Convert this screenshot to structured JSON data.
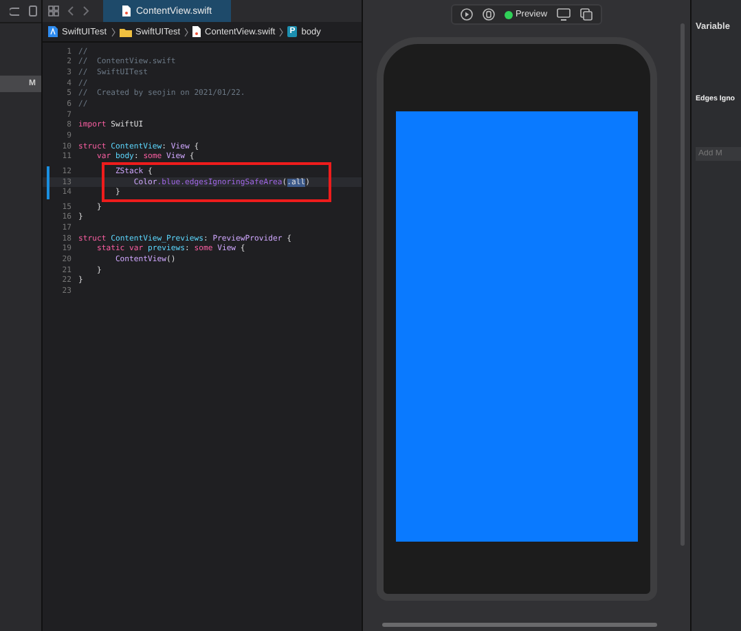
{
  "navigator": {
    "badge": "M"
  },
  "editor": {
    "tabs": [
      {
        "label": "ContentView.swift",
        "selected": true
      }
    ],
    "breadcrumb": [
      {
        "kind": "project",
        "label": "SwiftUITest"
      },
      {
        "kind": "folder",
        "label": "SwiftUITest"
      },
      {
        "kind": "file",
        "label": "ContentView.swift"
      },
      {
        "kind": "property",
        "badge": "P",
        "label": "body"
      }
    ],
    "lines": [
      {
        "number": "1",
        "changed": false,
        "current": false,
        "tokens": [
          {
            "kind": "comment",
            "text": "//"
          }
        ]
      },
      {
        "number": "2",
        "changed": false,
        "current": false,
        "tokens": [
          {
            "kind": "comment",
            "text": "//  ContentView.swift"
          }
        ]
      },
      {
        "number": "3",
        "changed": false,
        "current": false,
        "tokens": [
          {
            "kind": "comment",
            "text": "//  SwiftUITest"
          }
        ]
      },
      {
        "number": "4",
        "changed": false,
        "current": false,
        "tokens": [
          {
            "kind": "comment",
            "text": "//"
          }
        ]
      },
      {
        "number": "5",
        "changed": false,
        "current": false,
        "tokens": [
          {
            "kind": "comment",
            "text": "//  Created by seojin on 2021/01/22."
          }
        ]
      },
      {
        "number": "6",
        "changed": false,
        "current": false,
        "tokens": [
          {
            "kind": "comment",
            "text": "//"
          }
        ]
      },
      {
        "number": "7",
        "changed": false,
        "current": false
      },
      {
        "number": "8",
        "changed": false,
        "current": false,
        "tokens": [
          {
            "kind": "keyword",
            "text": "import "
          },
          {
            "kind": "plain",
            "text": "SwiftUI"
          }
        ]
      },
      {
        "number": "9",
        "changed": false,
        "current": false
      },
      {
        "number": "10",
        "changed": false,
        "current": false,
        "tokens": [
          {
            "kind": "keyword",
            "text": "struct "
          },
          {
            "kind": "decl",
            "text": "ContentView"
          },
          {
            "kind": "plain",
            "text": ": "
          },
          {
            "kind": "type",
            "text": "View"
          },
          {
            "kind": "plain",
            "text": " {"
          }
        ]
      },
      {
        "number": "11",
        "changed": false,
        "current": false,
        "tokens": [
          {
            "kind": "keyword",
            "text": "    var "
          },
          {
            "kind": "decl",
            "text": "body"
          },
          {
            "kind": "plain",
            "text": ": "
          },
          {
            "kind": "keyword",
            "text": "some "
          },
          {
            "kind": "type",
            "text": "View"
          },
          {
            "kind": "plain",
            "text": " {"
          }
        ]
      },
      {
        "number": "12",
        "changed": true,
        "current": false,
        "tokens": [
          {
            "kind": "type",
            "text": "        ZStack"
          },
          {
            "kind": "plain",
            "text": " {"
          }
        ]
      },
      {
        "number": "13",
        "changed": true,
        "current": true,
        "tokens": [
          {
            "kind": "type",
            "text": "            Color"
          },
          {
            "kind": "member",
            "text": ".blue"
          },
          {
            "kind": "member",
            "text": ".edgesIgnoringSafeArea"
          },
          {
            "kind": "plain",
            "text": "("
          },
          {
            "kind": "selection",
            "text": ".all"
          },
          {
            "kind": "plain",
            "text": ")"
          }
        ]
      },
      {
        "number": "14",
        "changed": true,
        "current": false,
        "tokens": [
          {
            "kind": "plain",
            "text": "        }"
          }
        ]
      },
      {
        "number": "15",
        "changed": false,
        "current": false,
        "tokens": [
          {
            "kind": "plain",
            "text": "    }"
          }
        ]
      },
      {
        "number": "16",
        "changed": false,
        "current": false,
        "tokens": [
          {
            "kind": "plain",
            "text": "}"
          }
        ]
      },
      {
        "number": "17",
        "changed": false,
        "current": false
      },
      {
        "number": "18",
        "changed": false,
        "current": false,
        "tokens": [
          {
            "kind": "keyword",
            "text": "struct "
          },
          {
            "kind": "decl",
            "text": "ContentView_Previews"
          },
          {
            "kind": "plain",
            "text": ": "
          },
          {
            "kind": "type",
            "text": "PreviewProvider"
          },
          {
            "kind": "plain",
            "text": " {"
          }
        ]
      },
      {
        "number": "19",
        "changed": false,
        "current": false,
        "tokens": [
          {
            "kind": "keyword",
            "text": "    static var "
          },
          {
            "kind": "decl",
            "text": "previews"
          },
          {
            "kind": "plain",
            "text": ": "
          },
          {
            "kind": "keyword",
            "text": "some "
          },
          {
            "kind": "type",
            "text": "View"
          },
          {
            "kind": "plain",
            "text": " {"
          }
        ]
      },
      {
        "number": "20",
        "changed": false,
        "current": false,
        "tokens": [
          {
            "kind": "type",
            "text": "        ContentView"
          },
          {
            "kind": "plain",
            "text": "()"
          }
        ]
      },
      {
        "number": "21",
        "changed": false,
        "current": false,
        "tokens": [
          {
            "kind": "plain",
            "text": "    }"
          }
        ]
      },
      {
        "number": "22",
        "changed": false,
        "current": false,
        "tokens": [
          {
            "kind": "plain",
            "text": "}"
          }
        ]
      },
      {
        "number": "23",
        "changed": false,
        "current": false
      }
    ]
  },
  "preview": {
    "label": "Preview",
    "live": true
  },
  "inspector": {
    "title": "Variable",
    "section": "Edges Igno",
    "field_placeholder": "Add M"
  }
}
